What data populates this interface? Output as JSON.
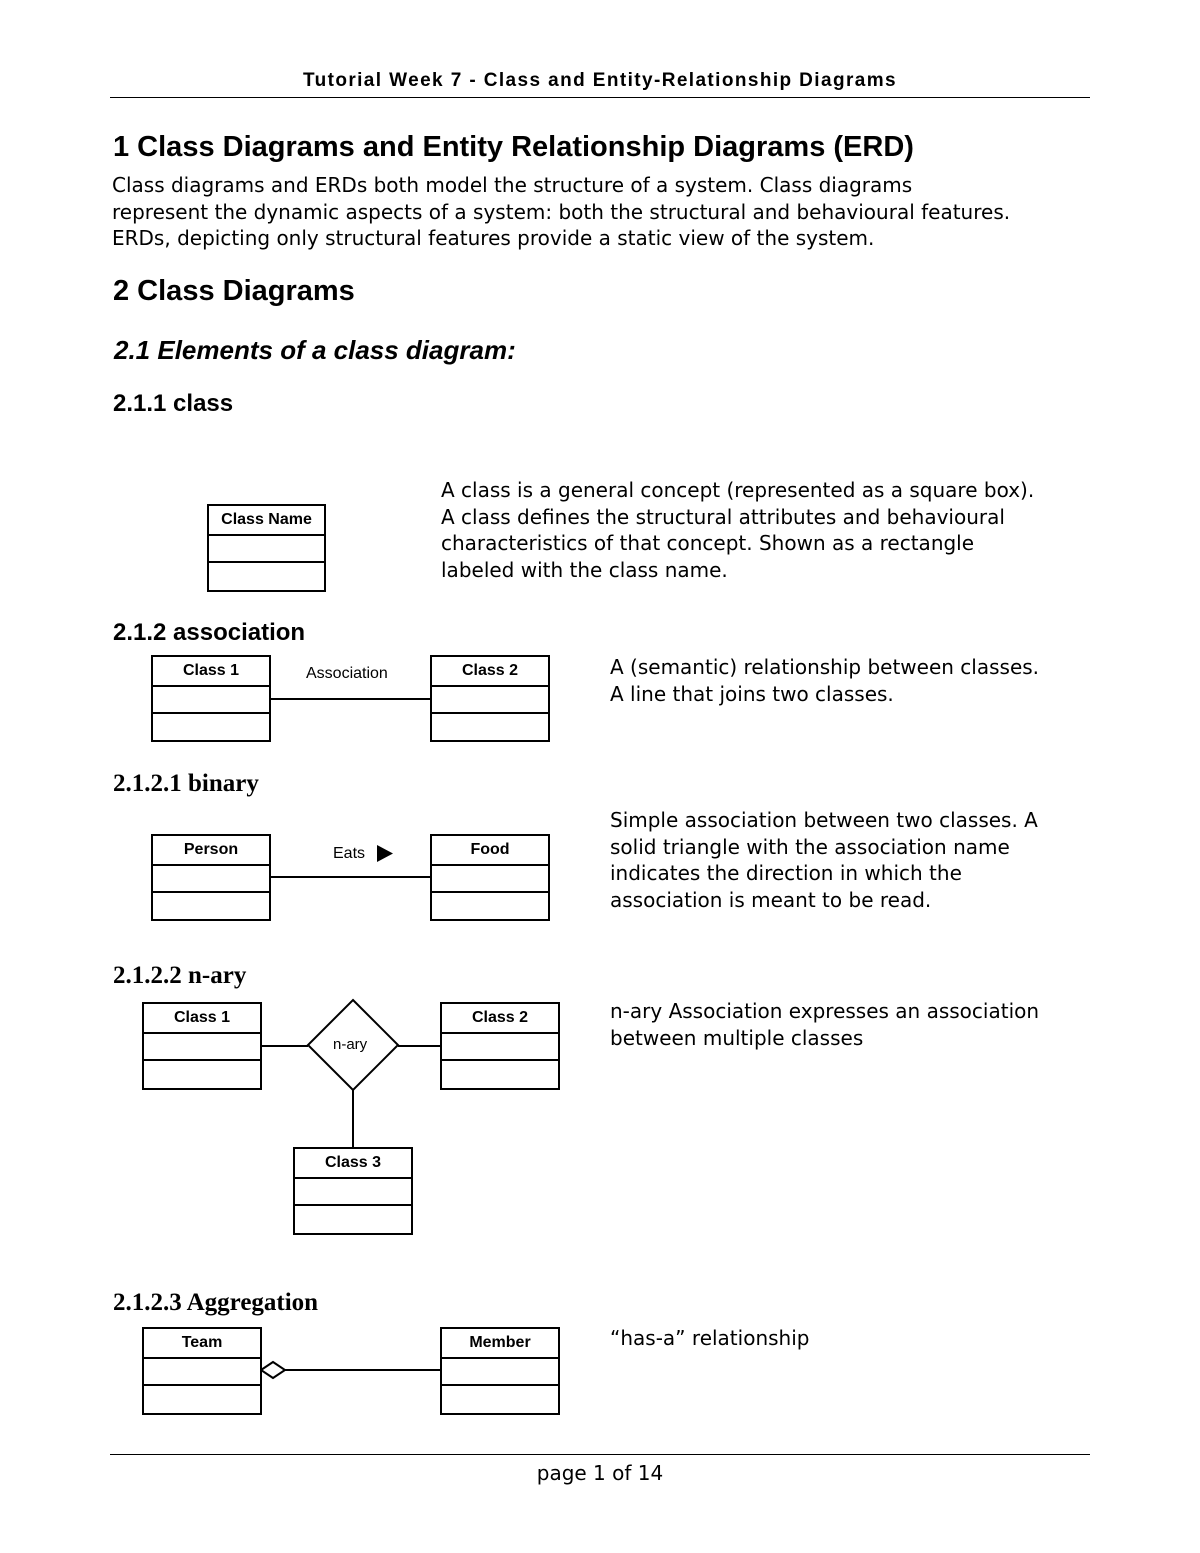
{
  "header": {
    "title": "Tutorial Week 7 - Class and Entity-Relationship Diagrams"
  },
  "sections": {
    "s1": {
      "heading": "1   Class Diagrams and Entity Relationship  Diagrams (ERD)",
      "body": "Class diagrams and ERDs both model the structure of a system.  Class diagrams\nrepresent the dynamic aspects of a system: both the structural and behavioural features.\nERDs, depicting only structural features  provide a static view of the system."
    },
    "s2": {
      "heading": "2   Class Diagrams"
    },
    "s2_1": {
      "heading": "2.1  Elements of a class diagram:"
    },
    "s2_1_1": {
      "heading": "2.1.1  class",
      "body": "A class is a general concept (represented as a square box).\nA class defines the structural attributes and behavioural\ncharacteristics of that concept.  Shown as a  rectangle\nlabeled with the class name.",
      "diagram": {
        "class_name": "Class Name"
      }
    },
    "s2_1_2": {
      "heading": "2.1.2  association",
      "body": "A (semantic) relationship between classes.\nA line that joins two classes.",
      "diagram": {
        "class_a": "Class 1",
        "class_b": "Class 2",
        "label": "Association"
      }
    },
    "s2_1_2_1": {
      "heading": "2.1.2.1 binary",
      "body": "Simple association between two classes.  A\nsolid triangle with the  association name\nindicates the direction in which the\nassociation is meant to be read.",
      "diagram": {
        "class_a": "Person",
        "class_b": "Food",
        "label": "Eats"
      }
    },
    "s2_1_2_2": {
      "heading": "2.1.2.2 n-ary",
      "body": "n-ary Association  expresses an association\nbetween multiple classes",
      "diagram": {
        "class_a": "Class 1",
        "class_b": "Class 2",
        "class_c": "Class 3",
        "label": "n-ary"
      }
    },
    "s2_1_2_3": {
      "heading": "2.1.2.3 Aggregation",
      "body": "“has-a” relationship",
      "diagram": {
        "class_a": "Team",
        "class_b": "Member"
      }
    }
  },
  "footer": {
    "page_label": "page 1 of 14"
  }
}
